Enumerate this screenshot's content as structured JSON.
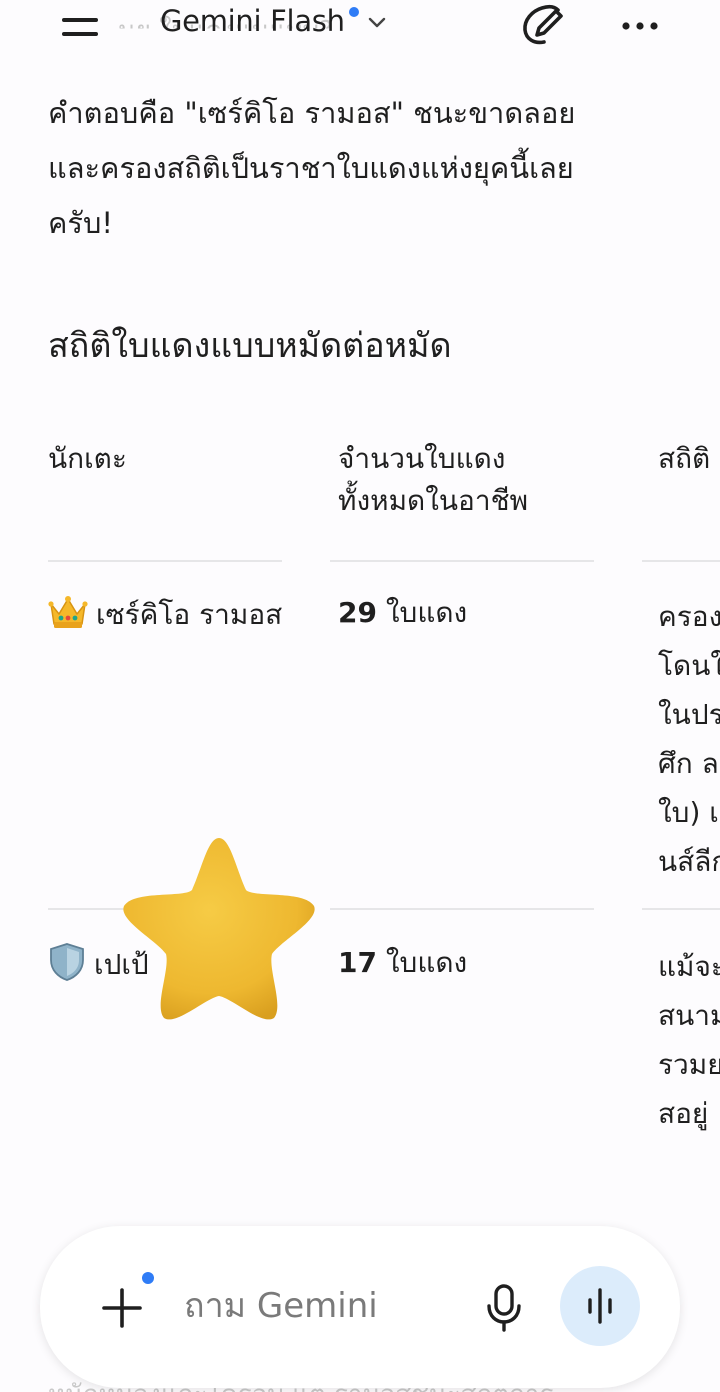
{
  "header": {
    "title": "Gemini Flash",
    "ghost_text": "นย ใบแดงแนแบบ?",
    "colors": {
      "dot": "#2f7cf6",
      "text": "#1f1f1f"
    },
    "icons": [
      "menu-icon",
      "chevron-down-icon",
      "edit-icon",
      "more-icon"
    ]
  },
  "answer": {
    "lines": [
      "คำตอบคือ \"เซร์คิโอ รามอส\" ชนะขาดลอย",
      "และครองสถิติเป็นราชาใบแดงแห่งยุคนี้เลย",
      "ครับ!"
    ]
  },
  "section": {
    "title": "สถิติใบแดงแบบหมัดต่อหมัด"
  },
  "table": {
    "headers": {
      "player": "นักเตะ",
      "reds_line1": "จำนวนใบแดง",
      "reds_line2": "ทั้งหมดในอาชีพ",
      "stat": "สถิติ"
    },
    "rows": [
      {
        "emoji": "crown-icon",
        "player": "เซร์คิโอ รามอส",
        "reds_num": "29",
        "reds_unit": "ใบแดง",
        "stat_lines": [
          "ครอง",
          "โดนใ",
          "ในปร",
          "ศึก ล",
          "ใบ) เ",
          "นส์ลีก"
        ]
      },
      {
        "emoji": "shield-icon",
        "player": "เปเป้",
        "reds_num": "17",
        "reds_unit": "ใบแดง",
        "stat_lines": [
          "แม้จะ",
          "สนาม",
          "รวมย",
          "สอยู่"
        ]
      }
    ]
  },
  "overlay": {
    "icon": "star-icon",
    "color": "#f2bf34"
  },
  "input": {
    "placeholder": "ถาม Gemini",
    "colors": {
      "voice_bg": "#dcecfb",
      "dot": "#2f7cf6"
    },
    "icons": [
      "plus-icon",
      "mic-icon",
      "voice-wave-icon"
    ]
  },
  "bottom_ghost": "หนักหน่วงแกะไครอบ แต่ รามอสชนะสถิติการ"
}
